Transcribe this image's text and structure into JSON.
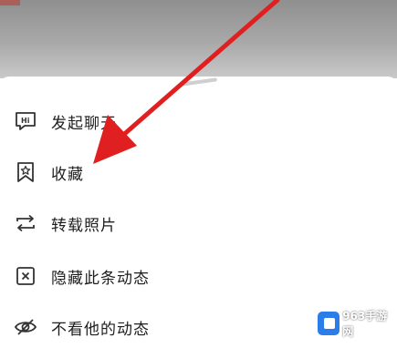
{
  "menu": {
    "items": [
      {
        "label": "发起聊天",
        "icon": "chat-hi-icon"
      },
      {
        "label": "收藏",
        "icon": "bookmark-star-icon"
      },
      {
        "label": "转载照片",
        "icon": "repost-icon"
      },
      {
        "label": "隐藏此条动态",
        "icon": "hide-box-x-icon"
      },
      {
        "label": "不看他的动态",
        "icon": "eye-off-icon"
      }
    ]
  },
  "annotation": {
    "color": "#e02020",
    "icon": "red-arrow-pointer"
  },
  "watermark": {
    "text": "963手游网",
    "icon": "site-logo-icon"
  }
}
